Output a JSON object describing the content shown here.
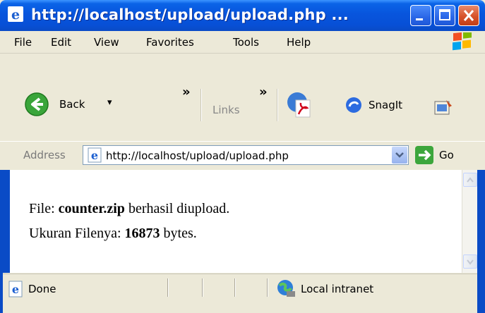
{
  "window": {
    "title": "http://localhost/upload/upload.php ..."
  },
  "menu": {
    "items": [
      "File",
      "Edit",
      "View",
      "Favorites",
      "Tools",
      "Help"
    ]
  },
  "toolbar": {
    "back_label": "Back",
    "back_arrow": "▾",
    "chevron": "»",
    "links_label": "Links",
    "snagit_label": "SnagIt"
  },
  "address": {
    "label": "Address",
    "url": "http://localhost/upload/upload.php",
    "go_label": "Go"
  },
  "content": {
    "line1_prefix": "File: ",
    "file_name": "counter.zip",
    "line1_suffix": " berhasil diupload.",
    "line2_prefix": "Ukuran Filenya: ",
    "file_size": "16873",
    "line2_suffix": " bytes."
  },
  "status": {
    "text": "Done",
    "zone": "Local intranet"
  },
  "colors": {
    "titlebar": "#0855dd",
    "close_button": "#d7522a",
    "chrome": "#ece9d8"
  }
}
